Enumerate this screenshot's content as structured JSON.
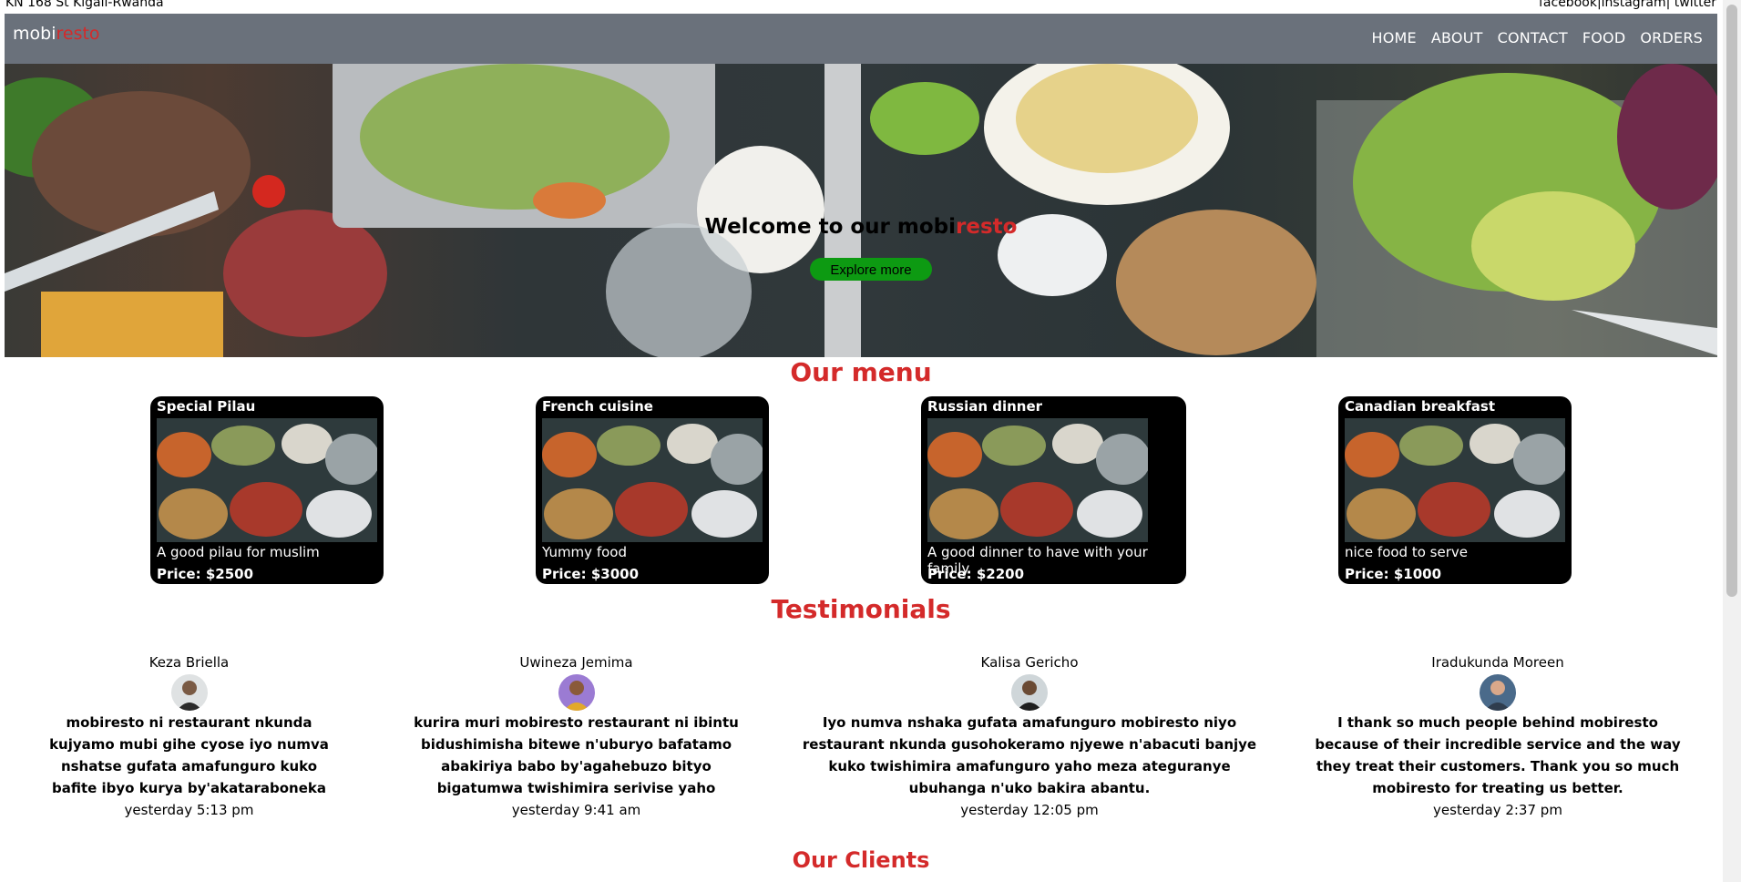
{
  "topbar": {
    "address": "KN 168 St Kigali-Rwanda",
    "social": [
      "facebook",
      "|instagram|",
      " twitter"
    ]
  },
  "brand": {
    "prefix": "mobi",
    "suffix": "resto",
    "accent_color": "#d42a2a"
  },
  "nav": [
    "HOME",
    "ABOUT",
    "CONTACT",
    "FOOD",
    "ORDERS"
  ],
  "hero": {
    "title_prefix": "Welcome to our mobi",
    "title_suffix": "resto",
    "button": "Explore more",
    "button_color": "#0d9a12"
  },
  "sections": {
    "menu": "Our menu",
    "testimonials": "Testimonials",
    "clients": "Our Clients"
  },
  "menu": [
    {
      "name": "Special Pilau",
      "description": "A good pilau for muslim",
      "price": "Price: $2500"
    },
    {
      "name": "French cuisine",
      "description": "Yummy food",
      "price": "Price: $3000"
    },
    {
      "name": "Russian dinner",
      "description": "A good dinner to have with your family",
      "price": "Price: $2200"
    },
    {
      "name": "Canadian breakfast",
      "description": "nice food to serve",
      "price": "Price: $1000"
    }
  ],
  "testimonials": [
    {
      "name": "Keza Briella",
      "quote": "mobiresto ni restaurant nkunda kujyamo mubi gihe cyose iyo numva nshatse gufata amafunguro kuko bafite ibyo kurya by'akataraboneka",
      "time": "yesterday 5:13 pm"
    },
    {
      "name": "Uwineza Jemima",
      "quote": "kurira muri mobiresto restaurant ni ibintu bidushimisha bitewe n'uburyo bafatamo abakiriya babo by'agahebuzo bityo bigatumwa twishimira serivise yaho",
      "time": "yesterday 9:41 am"
    },
    {
      "name": "Kalisa Gericho",
      "quote": "Iyo numva nshaka gufata amafunguro mobiresto niyo restaurant nkunda gusohokeramo njyewe n'abacuti banjye kuko twishimira amafunguro yaho meza ateguranye ubuhanga n'uko bakira abantu.",
      "time": "yesterday 12:05 pm"
    },
    {
      "name": "Iradukunda Moreen",
      "quote": "I thank so much people behind mobiresto because of their incredible service and the way they treat their customers. Thank you so much mobiresto for treating us better.",
      "time": "yesterday 2:37 pm"
    }
  ]
}
